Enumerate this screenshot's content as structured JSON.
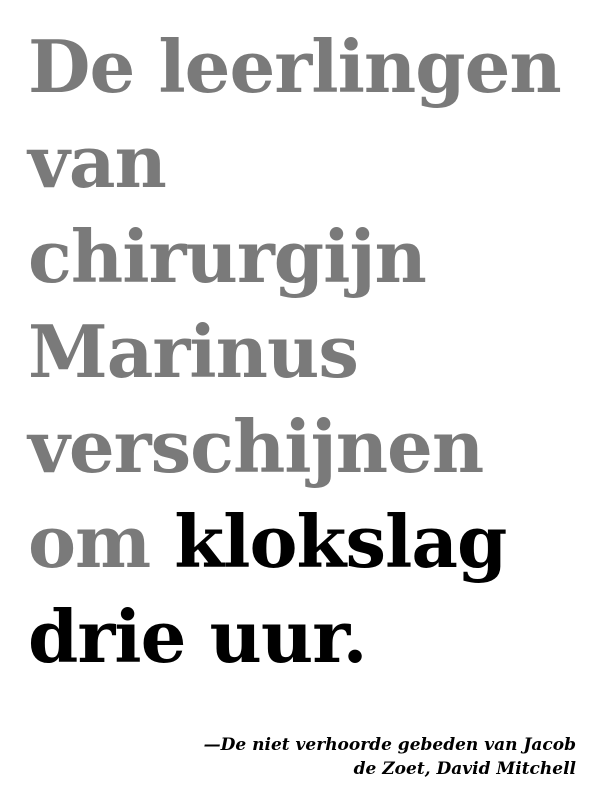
{
  "quote": {
    "lines": [
      "De leerlingen",
      "van",
      "chirurgijn",
      "Marinus",
      "verschijnen",
      "om",
      "klokslag",
      "drie uur."
    ],
    "muted_color": "#7a7a7a",
    "emphasis_color": "#000000"
  },
  "attribution": {
    "lines": [
      "—De niet verhoorde gebeden van Jacob",
      "de Zoet, David Mitchell"
    ]
  }
}
